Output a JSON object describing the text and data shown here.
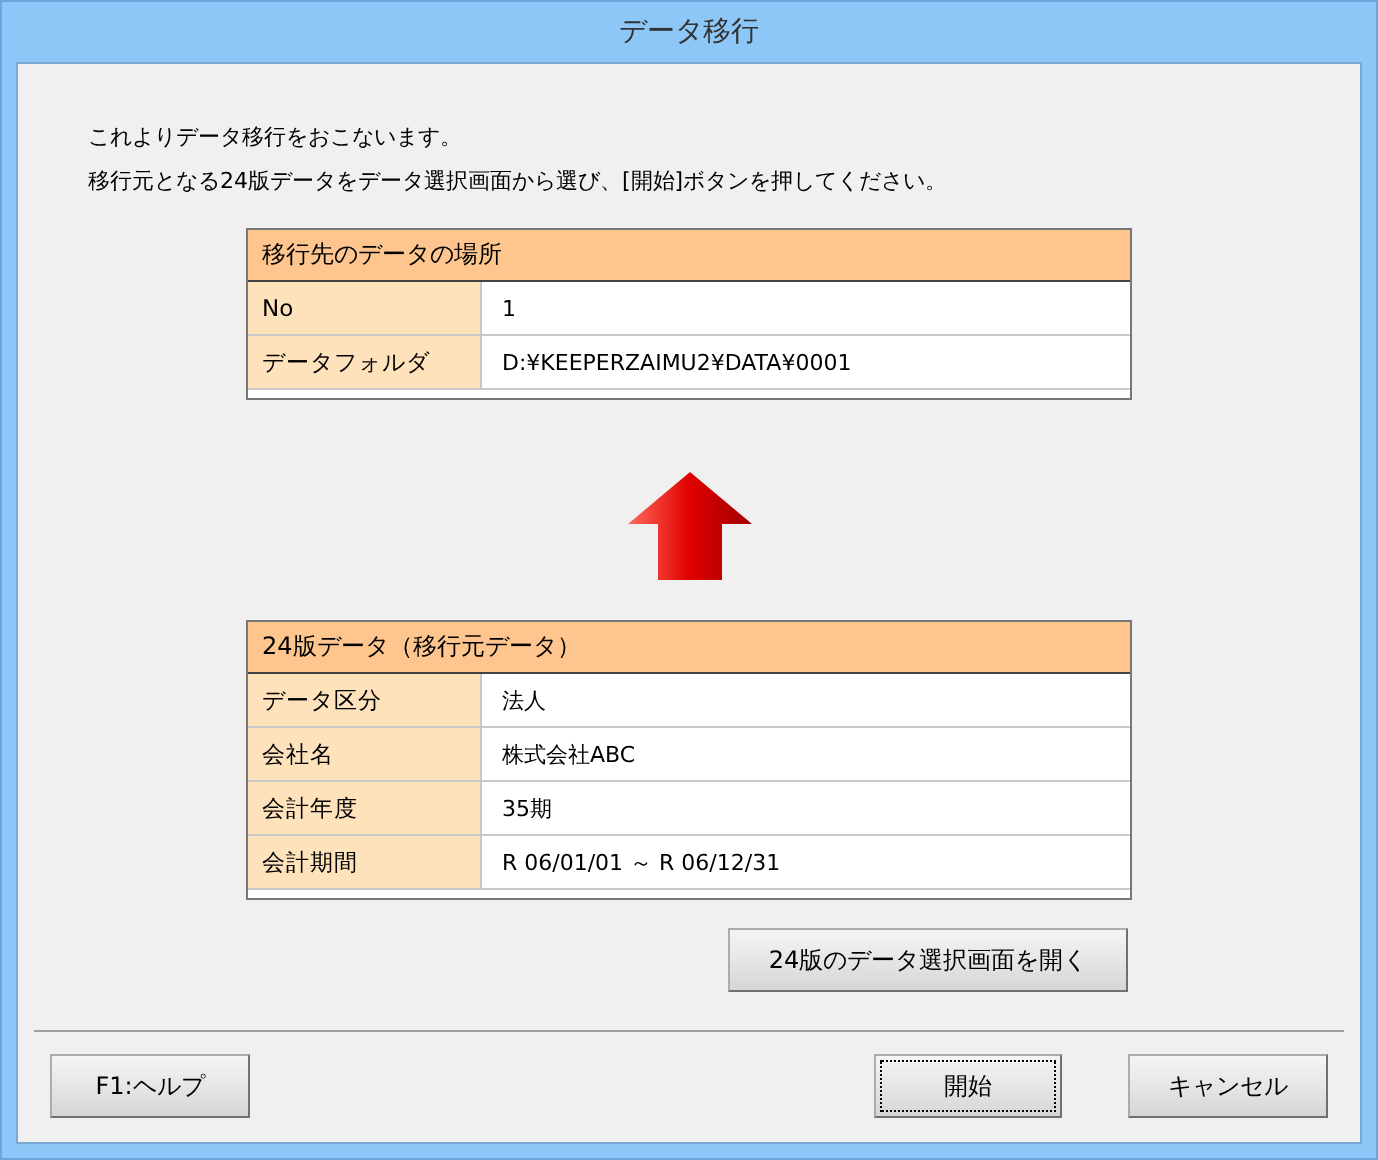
{
  "window": {
    "title": "データ移行"
  },
  "intro": [
    "これよりデータ移行をおこないます。",
    "移行元となる24版データをデータ選択画面から選び、[開始]ボタンを押してください。"
  ],
  "destination": {
    "heading": "移行先のデータの場所",
    "rows": [
      {
        "label": "No",
        "value": "1"
      },
      {
        "label": "データフォルダ",
        "value": "D:¥KEEPERZAIMU2¥DATA¥0001"
      }
    ]
  },
  "source": {
    "heading": "24版データ（移行元データ）",
    "rows": [
      {
        "label": "データ区分",
        "value": "法人"
      },
      {
        "label": "会社名",
        "value": "株式会社ABC"
      },
      {
        "label": "会計年度",
        "value": "35期"
      },
      {
        "label": "会計期間",
        "value": "R 06/01/01 ～ R 06/12/31"
      }
    ]
  },
  "select_button": "24版のデータ選択画面を開く",
  "footer_buttons": [
    {
      "label": "F1:ヘルプ",
      "focused": false
    },
    {
      "label": "開始",
      "focused": true
    },
    {
      "label": "キャンセル",
      "focused": false
    }
  ]
}
